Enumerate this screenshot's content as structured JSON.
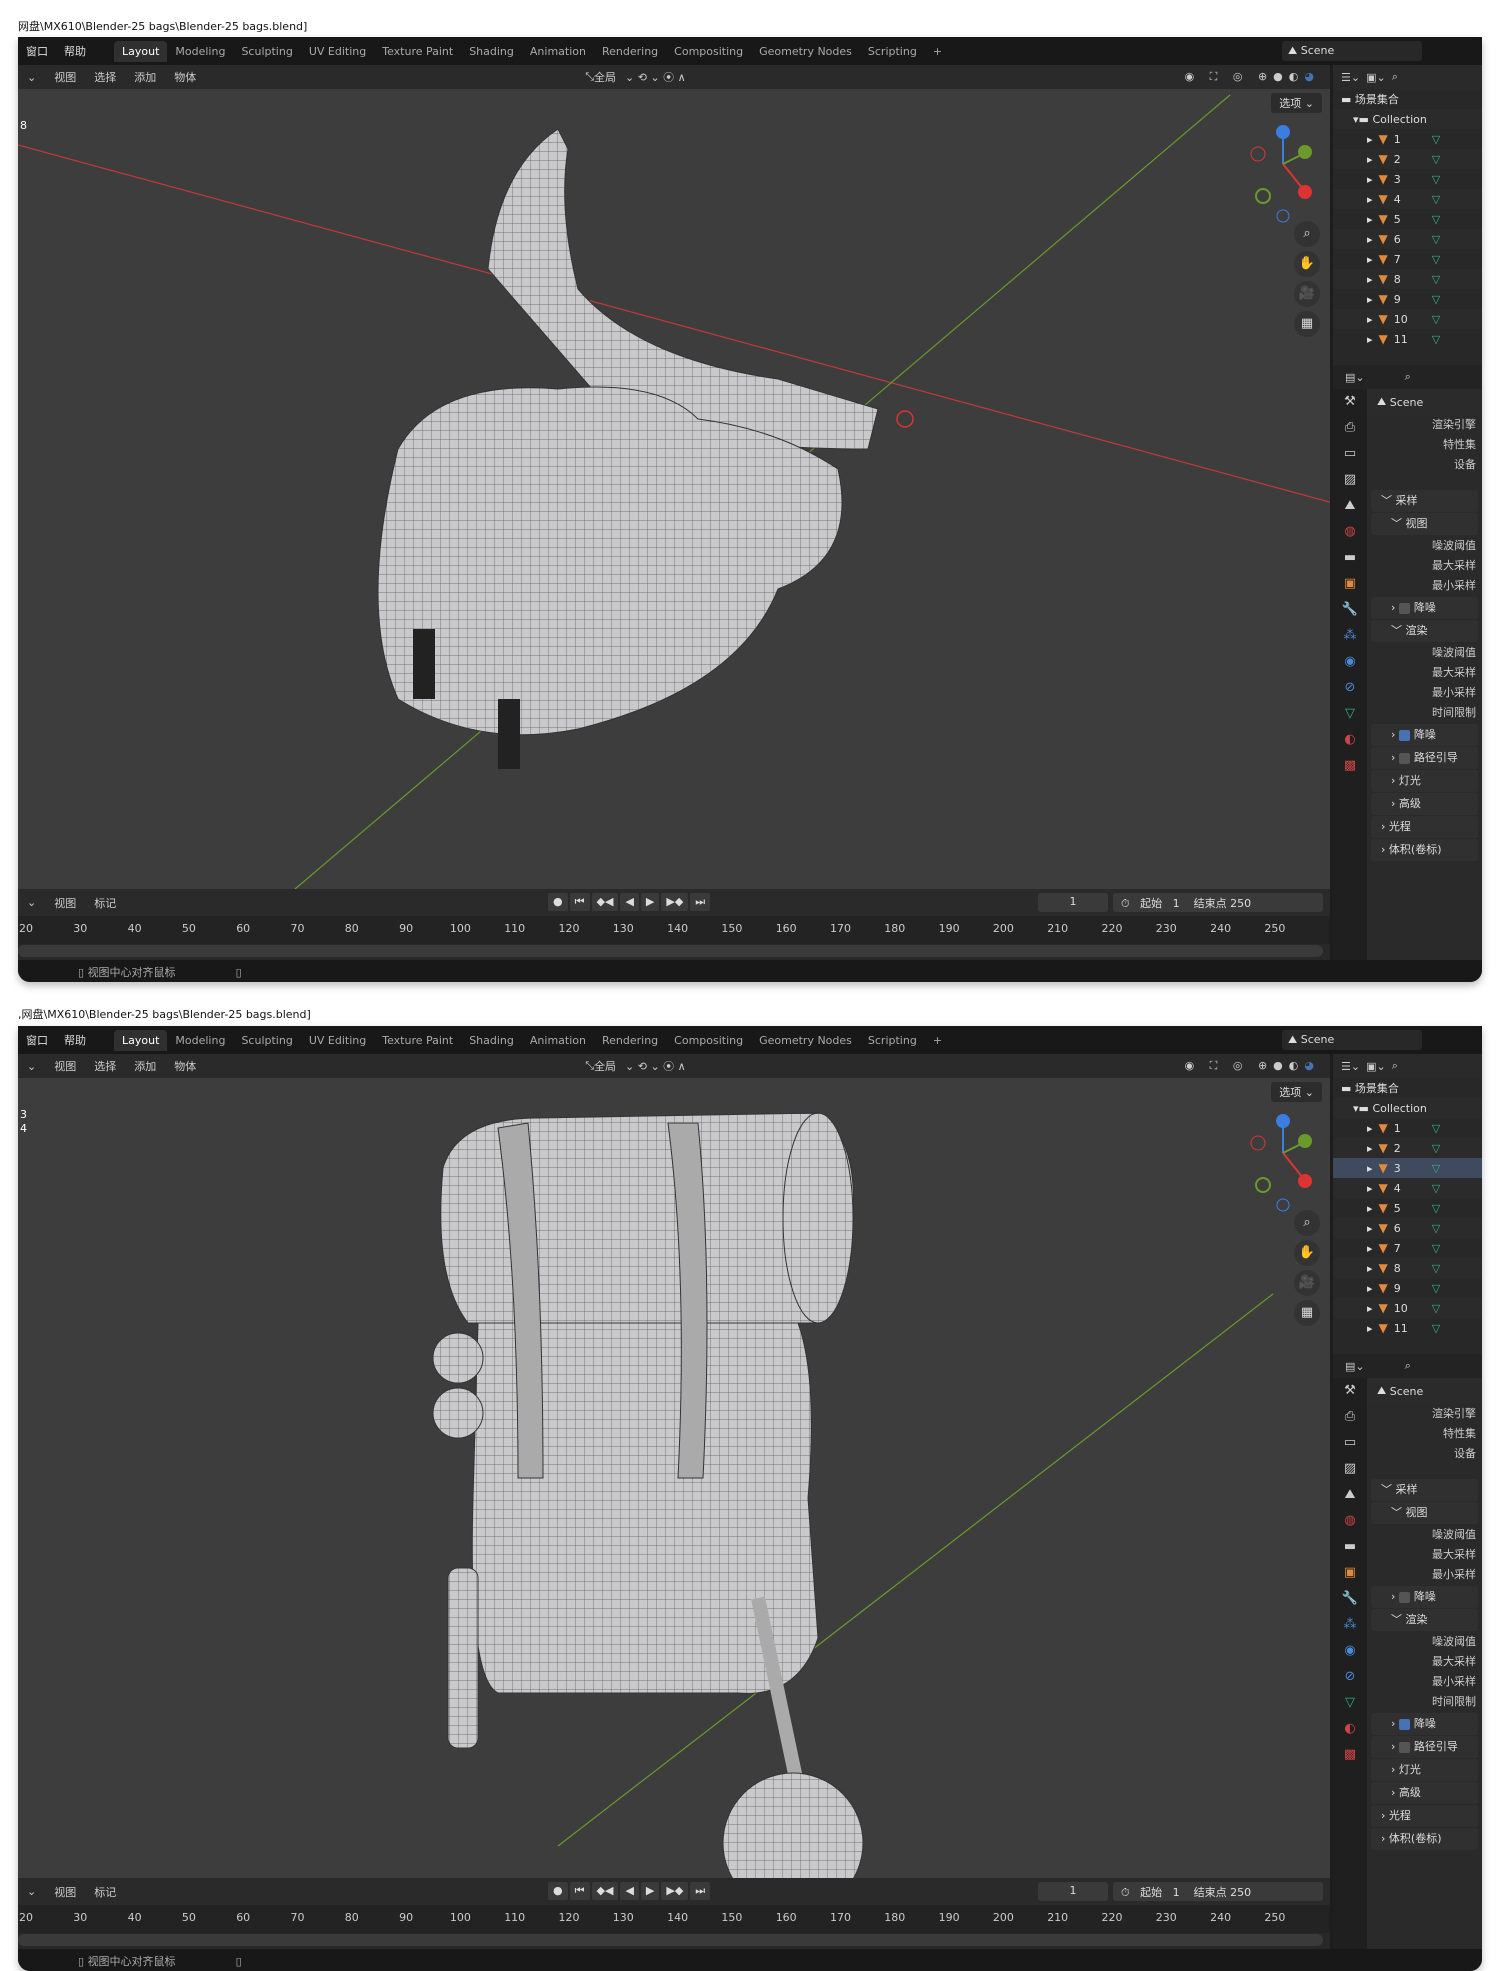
{
  "panels": [
    {
      "title": "网盘\\MX610\\Blender-25 bags\\Blender-25 bags.blend]",
      "variant": "satchel",
      "selected_row": -1,
      "viewport_labels": [
        "8"
      ]
    },
    {
      "title": ",网盘\\MX610\\Blender-25 bags\\Blender-25 bags.blend]",
      "variant": "backpack",
      "selected_row": 2,
      "viewport_labels": [
        "3",
        "4"
      ]
    }
  ],
  "menu": [
    "窗口",
    "帮助"
  ],
  "workspaces": [
    "Layout",
    "Modeling",
    "Sculpting",
    "UV Editing",
    "Texture Paint",
    "Shading",
    "Animation",
    "Rendering",
    "Compositing",
    "Geometry Nodes",
    "Scripting",
    "+"
  ],
  "active_workspace": "Layout",
  "scene_name": "Scene",
  "viewport_menu": [
    "视图",
    "选择",
    "添加",
    "物体"
  ],
  "transform_orientation": "全局",
  "options_label": "选项",
  "outliner": {
    "root": "场景集合",
    "collection": "Collection",
    "items": [
      "1",
      "2",
      "3",
      "4",
      "5",
      "6",
      "7",
      "8",
      "9",
      "10",
      "11"
    ]
  },
  "properties": {
    "scene": "Scene",
    "fields": [
      "渲染引擎",
      "特性集",
      "设备"
    ],
    "sampling": "采样",
    "viewport": "视图",
    "vp_fields": [
      "噪波阈值",
      "最大采样",
      "最小采样"
    ],
    "denoise": "降噪",
    "render": "渲染",
    "r_fields": [
      "噪波阈值",
      "最大采样",
      "最小采样",
      "时间限制"
    ],
    "denoise_checked": "降噪",
    "path_guiding": "路径引导",
    "lights": "灯光",
    "advanced": "高级",
    "light_paths": "光程",
    "volumes": "体积(卷标)"
  },
  "timeline": {
    "menu": [
      "视图",
      "标记"
    ],
    "current_frame": "1",
    "start_label": "起始",
    "start": "1",
    "end_label": "结束点",
    "end": "250",
    "ticks": [
      20,
      30,
      40,
      50,
      60,
      70,
      80,
      90,
      100,
      110,
      120,
      130,
      140,
      150,
      160,
      170,
      180,
      190,
      200,
      210,
      220,
      230,
      240,
      250
    ]
  },
  "status_text": "视图中心对齐鼠标",
  "colors": {
    "x_axis": "#c0393b",
    "y_axis": "#6a9a2c",
    "accent": "#4772b3",
    "mesh_icon": "#e28a3b",
    "data_icon": "#2fb28a"
  }
}
